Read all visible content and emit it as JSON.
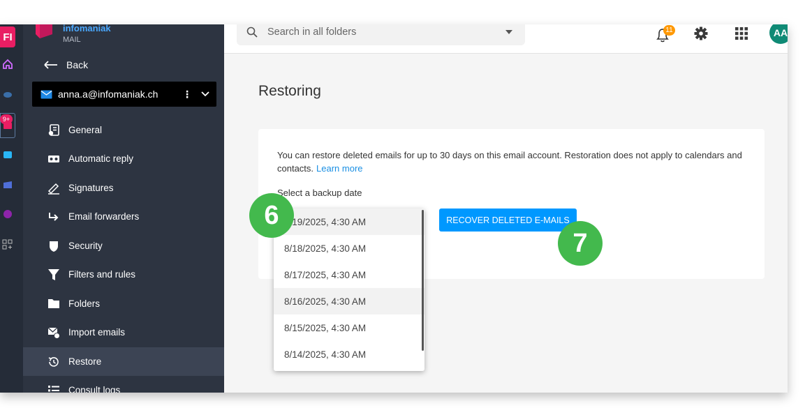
{
  "rail": {
    "badge_text": "FI",
    "notif_badge": "9+"
  },
  "sidebar": {
    "brand": "infomaniak",
    "brand_sub": "MAIL",
    "back_label": "Back",
    "account_email": "anna.a@infomaniak.ch",
    "items": [
      {
        "label": "General",
        "icon": "settings-doc-icon"
      },
      {
        "label": "Automatic reply",
        "icon": "voicemail-icon"
      },
      {
        "label": "Signatures",
        "icon": "signature-icon"
      },
      {
        "label": "Email forwarders",
        "icon": "forward-icon"
      },
      {
        "label": "Security",
        "icon": "shield-icon"
      },
      {
        "label": "Filters and rules",
        "icon": "filter-icon"
      },
      {
        "label": "Folders",
        "icon": "folder-icon"
      },
      {
        "label": "Import emails",
        "icon": "import-mail-icon"
      },
      {
        "label": "Restore",
        "icon": "restore-icon"
      },
      {
        "label": "Consult logs",
        "icon": "list-icon"
      }
    ]
  },
  "topbar": {
    "search_placeholder": "Search in all folders",
    "notification_count": "11",
    "avatar_initials": "AA"
  },
  "main": {
    "title": "Restoring",
    "description": "You can restore deleted emails for up to 30 days on this email account. Restoration does not apply to calendars and contacts.",
    "learn_more": "Learn more",
    "backup_label": "Select a backup date",
    "recover_button": "RECOVER DELETED E-MAILS"
  },
  "dropdown": {
    "options": [
      "8/19/2025, 4:30 AM",
      "8/18/2025, 4:30 AM",
      "8/17/2025, 4:30 AM",
      "8/16/2025, 4:30 AM",
      "8/15/2025, 4:30 AM",
      "8/14/2025, 4:30 AM"
    ]
  },
  "steps": {
    "six": "6",
    "seven": "7"
  },
  "colors": {
    "accent": "#0098ff",
    "step_marker": "#43b94d",
    "sidebar_bg": "#2d3441",
    "brand_pink": "#e91e63"
  }
}
